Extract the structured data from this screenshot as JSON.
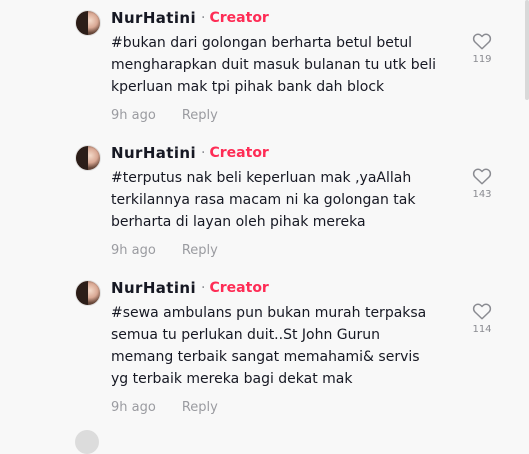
{
  "comments": [
    {
      "username": "NurHatini",
      "separator": "·",
      "badge": "Creator",
      "text": "#bukan dari golongan berharta betul betul mengharapkan duit masuk bulanan tu utk beli kperluan mak tpi pihak bank dah block",
      "time": "9h ago",
      "reply_label": "Reply",
      "likes": "119",
      "like_icon": "heart-outline-icon"
    },
    {
      "username": "NurHatini",
      "separator": "·",
      "badge": "Creator",
      "text": "#terputus nak beli keperluan mak ,yaAllah terkilannya rasa macam ni ka golongan tak berharta di layan oleh pihak mereka",
      "time": "9h ago",
      "reply_label": "Reply",
      "likes": "143",
      "like_icon": "heart-outline-icon"
    },
    {
      "username": "NurHatini",
      "separator": "·",
      "badge": "Creator",
      "text": "#sewa ambulans pun bukan murah terpaksa semua tu perlukan duit..St John Gurun memang terbaik sangat memahami& servis yg terbaik mereka bagi dekat mak",
      "time": "9h ago",
      "reply_label": "Reply",
      "likes": "114",
      "like_icon": "heart-outline-icon"
    }
  ],
  "colors": {
    "background": "#f8f8f8",
    "text": "#161823",
    "creator_badge": "#fe2c55",
    "muted": "#9a9ba0"
  }
}
